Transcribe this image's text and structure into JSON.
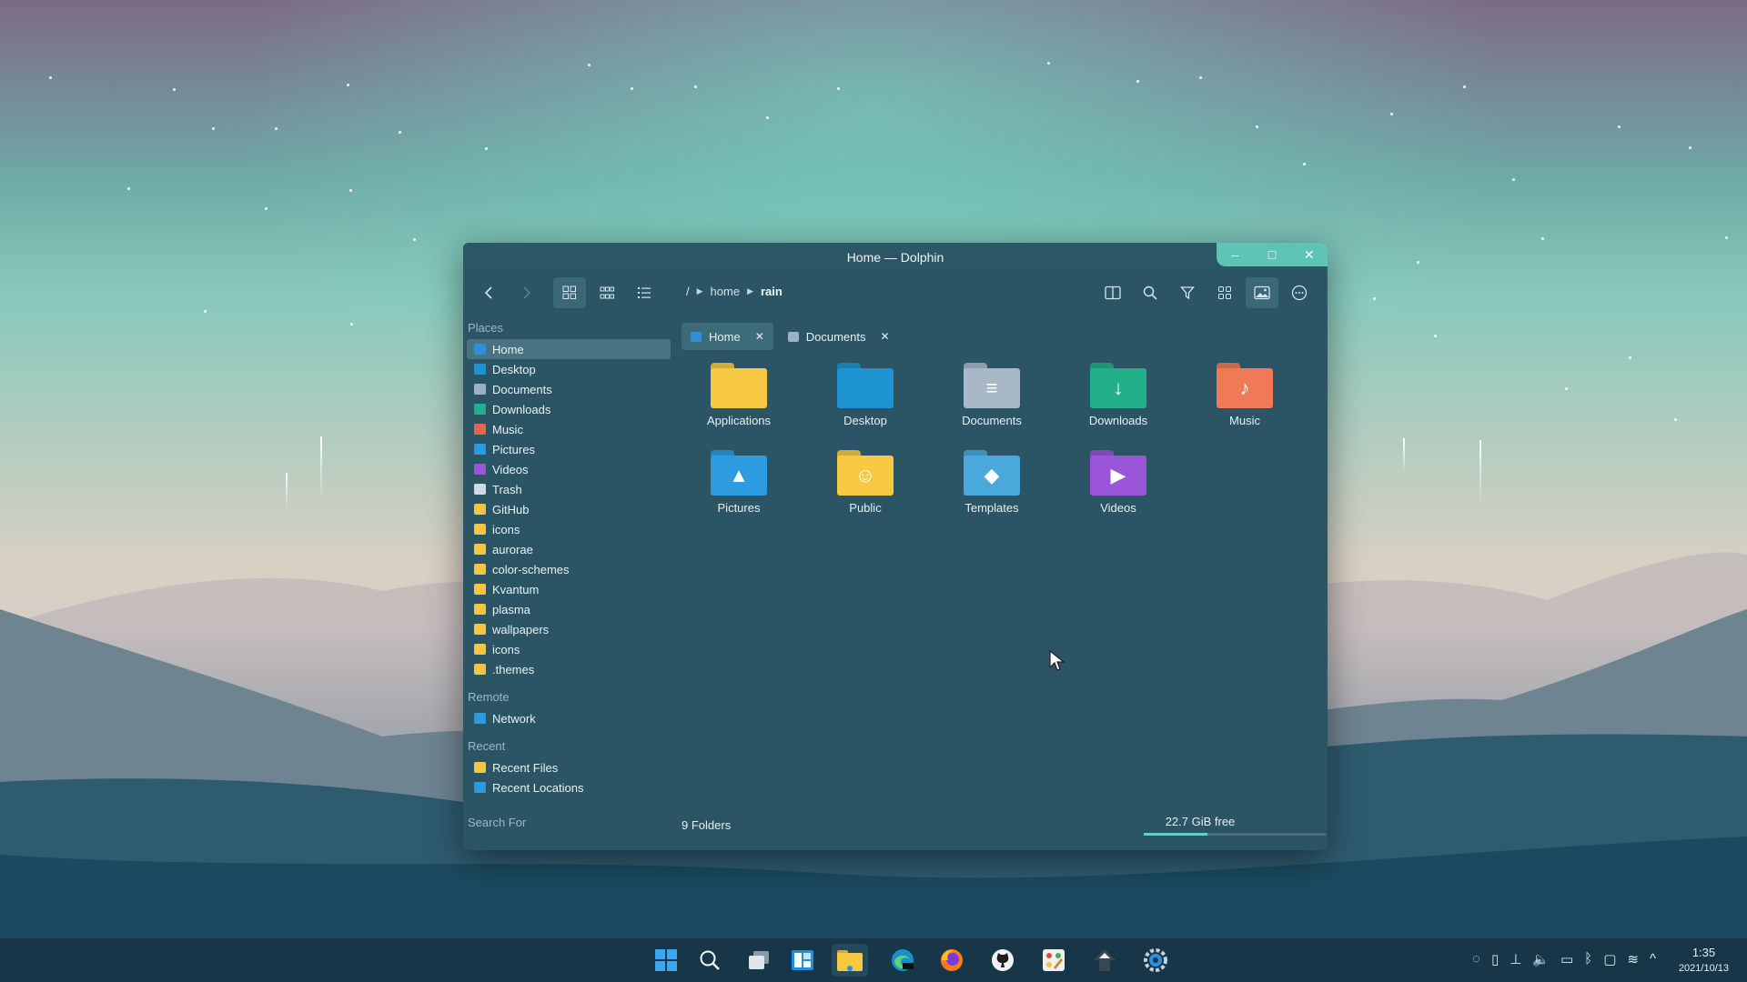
{
  "window": {
    "title": "Home — Dolphin",
    "breadcrumb": [
      "/",
      "home",
      "rain"
    ]
  },
  "sidebar": {
    "places_label": "Places",
    "places": [
      {
        "label": "Home",
        "icon": "home-icon",
        "color": "#2f8fd8",
        "selected": true
      },
      {
        "label": "Desktop",
        "icon": "desktop-icon",
        "color": "#1d93d1"
      },
      {
        "label": "Documents",
        "icon": "document-icon",
        "color": "#9db1c4"
      },
      {
        "label": "Downloads",
        "icon": "download-icon",
        "color": "#23b08e"
      },
      {
        "label": "Music",
        "icon": "music-icon",
        "color": "#e0674c"
      },
      {
        "label": "Pictures",
        "icon": "picture-icon",
        "color": "#2d9be0"
      },
      {
        "label": "Videos",
        "icon": "video-icon",
        "color": "#9a55d8"
      },
      {
        "label": "Trash",
        "icon": "trash-icon",
        "color": "#cfdbe3"
      },
      {
        "label": "GitHub",
        "icon": "folder-icon",
        "color": "#f6c643"
      },
      {
        "label": "icons",
        "icon": "folder-icon",
        "color": "#f6c643"
      },
      {
        "label": "aurorae",
        "icon": "folder-icon",
        "color": "#f6c643"
      },
      {
        "label": "color-schemes",
        "icon": "folder-icon",
        "color": "#f6c643"
      },
      {
        "label": "Kvantum",
        "icon": "folder-icon",
        "color": "#f6c643"
      },
      {
        "label": "plasma",
        "icon": "folder-icon",
        "color": "#f6c643"
      },
      {
        "label": "wallpapers",
        "icon": "folder-icon",
        "color": "#f6c643"
      },
      {
        "label": "icons",
        "icon": "folder-icon",
        "color": "#f6c643"
      },
      {
        "label": ".themes",
        "icon": "folder-icon",
        "color": "#f6c643"
      }
    ],
    "remote_label": "Remote",
    "remote": [
      {
        "label": "Network",
        "icon": "network-icon",
        "color": "#2d9be0"
      }
    ],
    "recent_label": "Recent",
    "recent": [
      {
        "label": "Recent Files",
        "icon": "recent-files-icon",
        "color": "#f6c643"
      },
      {
        "label": "Recent Locations",
        "icon": "recent-locations-icon",
        "color": "#2d9be0"
      }
    ],
    "search_label": "Search For"
  },
  "tabs": [
    {
      "label": "Home",
      "active": true,
      "color": "#2f8fd8"
    },
    {
      "label": "Documents",
      "active": false,
      "color": "#9db1c4"
    }
  ],
  "files": [
    {
      "label": "Applications",
      "color": "#f7c844",
      "glyph": ""
    },
    {
      "label": "Desktop",
      "color": "#1d93d1",
      "glyph": ""
    },
    {
      "label": "Documents",
      "color": "#a9b8c7",
      "glyph": "≡"
    },
    {
      "label": "Downloads",
      "color": "#22b089",
      "glyph": "↓"
    },
    {
      "label": "Music",
      "color": "#ef7a55",
      "glyph": "♪"
    },
    {
      "label": "Pictures",
      "color": "#2d9be0",
      "glyph": "▲"
    },
    {
      "label": "Public",
      "color": "#f7c844",
      "glyph": "☺"
    },
    {
      "label": "Templates",
      "color": "#49a9db",
      "glyph": "◆"
    },
    {
      "label": "Videos",
      "color": "#9a55d8",
      "glyph": "▶"
    }
  ],
  "status": {
    "folders": "9 Folders",
    "free": "22.7 GiB free",
    "free_fraction": 0.35
  },
  "taskbar": {
    "apps": [
      "windows-start-icon",
      "search-icon",
      "task-view-icon",
      "widgets-icon",
      "file-manager-icon",
      "edge-dev-icon",
      "firefox-icon",
      "github-icon",
      "kolourpaint-icon",
      "update-icon",
      "settings-icon"
    ],
    "active_app": "file-manager-icon",
    "time": "1:35",
    "date": "2021/10/13"
  }
}
